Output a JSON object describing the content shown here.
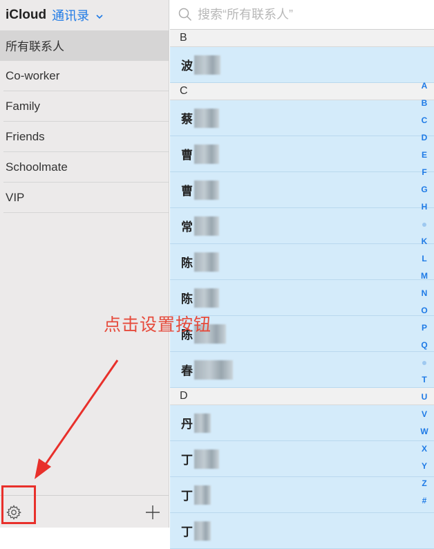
{
  "sidebar": {
    "brand": "iCloud",
    "book_title": "通讯录",
    "groups": [
      {
        "label": "所有联系人"
      },
      {
        "label": "Co-worker"
      },
      {
        "label": "Family"
      },
      {
        "label": "Friends"
      },
      {
        "label": "Schoolmate"
      },
      {
        "label": "VIP"
      }
    ]
  },
  "search": {
    "placeholder": "搜索“所有联系人”"
  },
  "sections": {
    "b": "B",
    "c": "C",
    "d": "D"
  },
  "contacts": [
    {
      "initial": "波"
    },
    {
      "initial": "蔡"
    },
    {
      "initial": "曹"
    },
    {
      "initial": "曹"
    },
    {
      "initial": "常"
    },
    {
      "initial": "陈"
    },
    {
      "initial": "陈"
    },
    {
      "initial": "陈"
    },
    {
      "initial": "春"
    },
    {
      "initial": "丹"
    },
    {
      "initial": "丁"
    },
    {
      "initial": "丁"
    },
    {
      "initial": "丁"
    }
  ],
  "index_letters": [
    "A",
    "B",
    "C",
    "D",
    "E",
    "F",
    "G",
    "H",
    "•",
    "K",
    "L",
    "M",
    "N",
    "O",
    "P",
    "Q",
    "•",
    "T",
    "U",
    "V",
    "W",
    "X",
    "Y",
    "Z",
    "#"
  ],
  "annotation": {
    "text": "点击设置按钮"
  },
  "colors": {
    "accent": "#1e7ae6",
    "annotation": "#e64a3b",
    "row": "#d4ebfa"
  }
}
